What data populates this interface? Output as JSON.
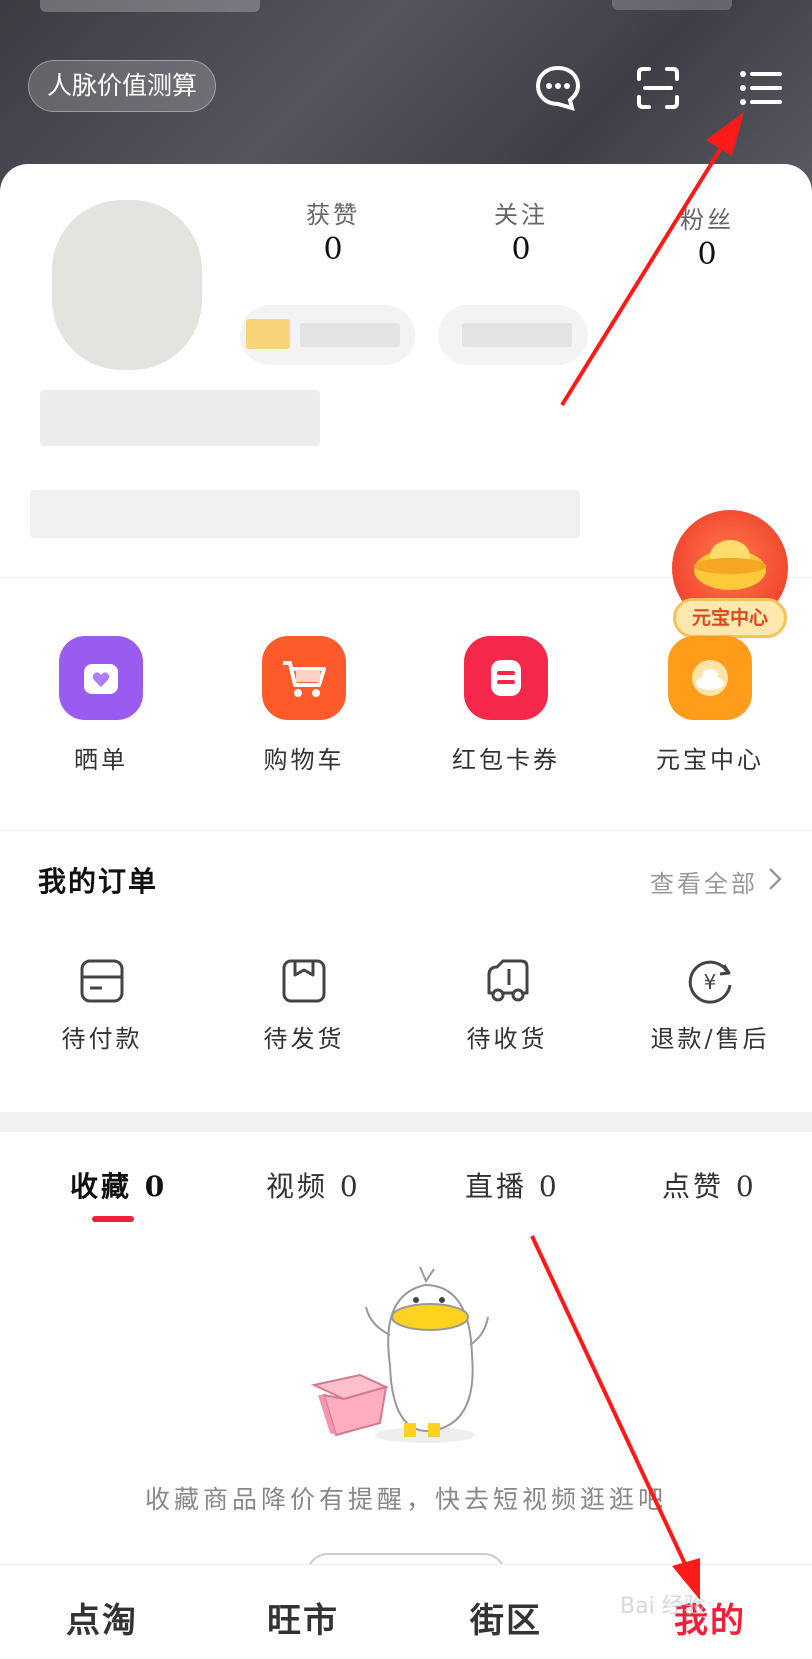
{
  "header": {
    "pill_label": "人脉价值测算",
    "icons": [
      "message-icon",
      "scan-icon",
      "menu-list-icon"
    ]
  },
  "profile": {
    "stats": [
      {
        "label": "获赞",
        "value": "0"
      },
      {
        "label": "关注",
        "value": "0"
      },
      {
        "label": "粉丝",
        "value": "0"
      }
    ]
  },
  "coin_float": {
    "label": "元宝中心"
  },
  "quick_actions": [
    {
      "label": "晒单",
      "icon": "heart-bag-icon",
      "color": "#9a5cf0"
    },
    {
      "label": "购物车",
      "icon": "cart-icon",
      "color": "#ff5a2a"
    },
    {
      "label": "红包卡券",
      "icon": "coupon-icon",
      "color": "#f5274a"
    },
    {
      "label": "元宝中心",
      "icon": "ingot-icon",
      "color": "#ff9d1a"
    }
  ],
  "orders": {
    "title": "我的订单",
    "view_all": "查看全部",
    "items": [
      {
        "label": "待付款",
        "icon": "wallet-icon"
      },
      {
        "label": "待发货",
        "icon": "package-icon"
      },
      {
        "label": "待收货",
        "icon": "truck-icon"
      },
      {
        "label": "退款/售后",
        "icon": "refund-icon"
      }
    ]
  },
  "tabs": [
    {
      "label": "收藏 0",
      "active": true
    },
    {
      "label": "视频 0",
      "active": false
    },
    {
      "label": "直播 0",
      "active": false
    },
    {
      "label": "点赞 0",
      "active": false
    }
  ],
  "empty_state": {
    "message": "收藏商品降价有提醒，快去短视频逛逛吧"
  },
  "bottom_nav": [
    {
      "label": "点淘",
      "active": false
    },
    {
      "label": "旺市",
      "active": false
    },
    {
      "label": "街区",
      "active": false
    },
    {
      "label": "我的",
      "active": true
    }
  ],
  "colors": {
    "accent": "#f0203b",
    "annotation_arrow": "#ff1a1a"
  },
  "watermark": "Bai 经验"
}
